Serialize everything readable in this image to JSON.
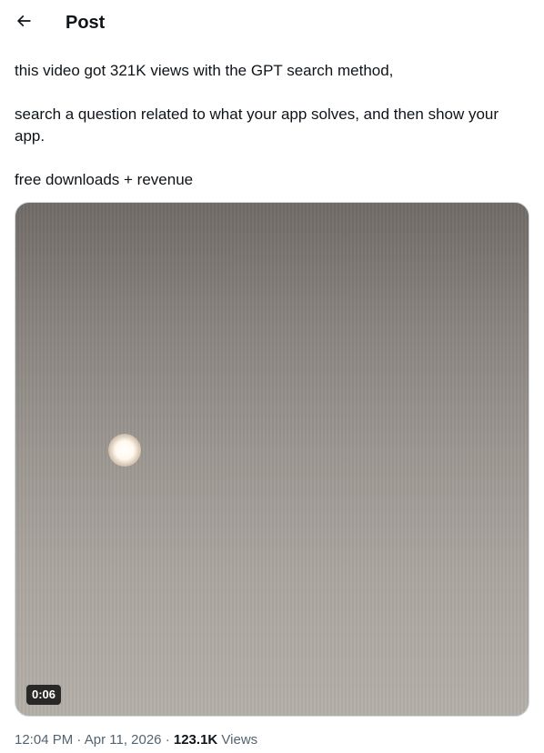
{
  "header": {
    "title": "Post",
    "back_icon": "arrow-left-icon"
  },
  "post": {
    "paragraphs": [
      "this video got 321K views with the GPT search method,",
      "search a question related to what your app solves, and then show your app.",
      "free downloads + revenue"
    ]
  },
  "media": {
    "type": "video",
    "duration": "0:06"
  },
  "meta": {
    "time": "12:04 PM",
    "separator": "·",
    "date": "Apr 11, 2026",
    "views_count": "123.1K",
    "views_label": "Views"
  },
  "colors": {
    "text_primary": "#0f1419",
    "text_secondary": "#536471",
    "border": "#cfd9de"
  }
}
